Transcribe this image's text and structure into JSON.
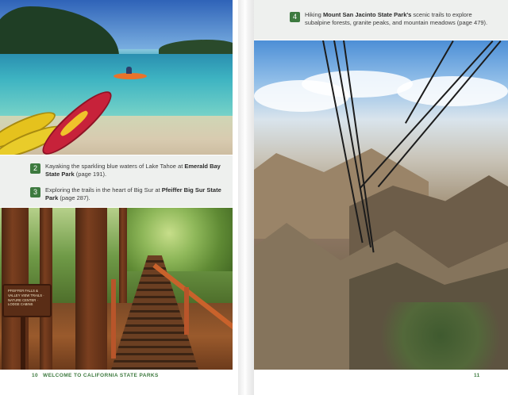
{
  "spread": {
    "left_page": {
      "captions": [
        {
          "number": "2",
          "text_before": "Kayaking the sparkling blue waters of Lake Tahoe at ",
          "bold": "Emerald Bay State Park",
          "text_after": " (page 191)."
        },
        {
          "number": "3",
          "text_before": "Exploring the trails in the heart of Big Sur at ",
          "bold": "Pfeiffer Big Sur State Park",
          "text_after": " (page 287)."
        }
      ],
      "sign_text": "Pfeiffer Falls & Valley View Trails · Nature Center · Lodge Cabins",
      "footer": {
        "page_number": "10",
        "running_head": "WELCOME TO CALIFORNIA STATE PARKS"
      }
    },
    "right_page": {
      "caption": {
        "number": "4",
        "text_before": "Hiking ",
        "bold": "Mount San Jacinto State Park's",
        "text_after": " scenic trails to explore subalpine forests, granite peaks, and mountain meadows (page 479)."
      },
      "footer": {
        "page_number": "11"
      }
    },
    "colors": {
      "accent_green": "#3d7a3f",
      "caption_background": "#eef0ee"
    }
  }
}
